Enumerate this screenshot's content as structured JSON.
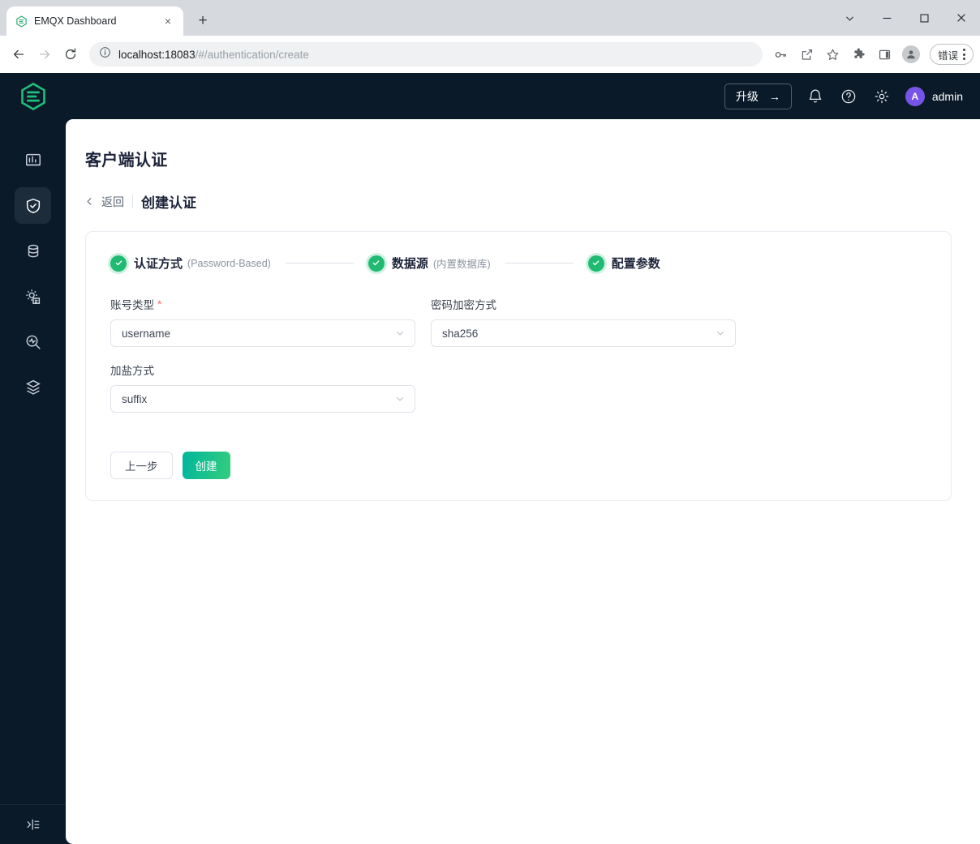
{
  "browser": {
    "tab": {
      "title": "EMQX Dashboard",
      "favicon": "emqx-hexagon-icon",
      "close": "×"
    },
    "new_tab_label": "+",
    "window_controls": {
      "tab_search": "tab-search-chevron",
      "minimize": "—",
      "maximize": "□",
      "close": "✕"
    },
    "url": {
      "host": "localhost:18083",
      "path": "/#/authentication/create"
    },
    "error_pill": "错误"
  },
  "sidebar": {
    "logo": "emqx-logo",
    "items": [
      {
        "name": "dashboard",
        "icon": "chart-bars-icon",
        "active": false
      },
      {
        "name": "access-control",
        "icon": "shield-check-icon",
        "active": true
      },
      {
        "name": "data-integration",
        "icon": "database-sync-icon",
        "active": false
      },
      {
        "name": "management",
        "icon": "gear-document-icon",
        "active": false
      },
      {
        "name": "diagnose",
        "icon": "magnifier-pulse-icon",
        "active": false
      },
      {
        "name": "extensions",
        "icon": "layers-hexagon-icon",
        "active": false
      }
    ],
    "collapse": "collapse-sidebar-icon"
  },
  "topbar": {
    "upgrade_label": "升级",
    "upgrade_arrow": "→",
    "icons": [
      "bell-icon",
      "help-circle-icon",
      "gear-icon"
    ],
    "avatar_initial": "A",
    "user_name": "admin"
  },
  "page": {
    "title": "客户端认证",
    "breadcrumb": {
      "back": "返回",
      "current": "创建认证"
    }
  },
  "steps": [
    {
      "name": "认证方式",
      "sub": "(Password-Based)",
      "done": true
    },
    {
      "name": "数据源",
      "sub": "(内置数据库)",
      "done": true
    },
    {
      "name": "配置参数",
      "sub": "",
      "done": true
    }
  ],
  "form": {
    "fields": [
      {
        "label": "账号类型",
        "required": true,
        "value": "username",
        "name": "account-type"
      },
      {
        "label": "密码加密方式",
        "required": false,
        "value": "sha256",
        "name": "password-hash-algorithm"
      },
      {
        "label": "加盐方式",
        "required": false,
        "value": "suffix",
        "name": "salt-position"
      }
    ]
  },
  "actions": {
    "prev": "上一步",
    "create": "创建"
  },
  "colors": {
    "sidebar_bg": "#0b1a28",
    "sidebar_active": "#1d2c3a",
    "brand_green": "#21ba72",
    "primary_from": "#00b69c",
    "primary_to": "#34cd7d",
    "avatar_purple": "#7654e8",
    "required_red": "#f56c6c"
  }
}
